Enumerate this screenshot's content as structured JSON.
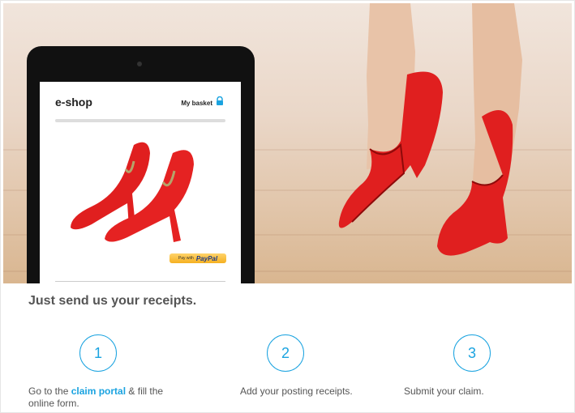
{
  "hero": {
    "shop": {
      "name": "e-shop",
      "basket_label": "My basket",
      "paypal_small": "Pay with",
      "paypal_brand": "PayPal"
    }
  },
  "headline": "Just send us your receipts.",
  "steps": [
    {
      "number": "1",
      "text_before": "Go to the ",
      "link": "claim portal",
      "text_after": " & fill the online form."
    },
    {
      "number": "2",
      "text": "Add your posting receipts."
    },
    {
      "number": "3",
      "text": "Submit your claim."
    }
  ],
  "colors": {
    "accent": "#1aa3e0",
    "shoe_red": "#e01f1f",
    "text": "#555555"
  }
}
